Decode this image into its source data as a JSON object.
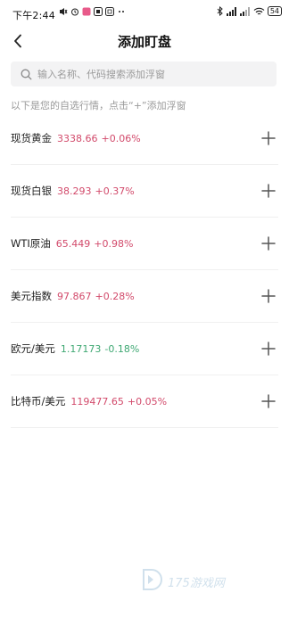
{
  "status_bar": {
    "time": "下午2:44",
    "battery": "54"
  },
  "header": {
    "title": "添加盯盘"
  },
  "search": {
    "placeholder": "输入名称、代码搜索添加浮窗"
  },
  "hint": "以下是您的自选行情，点击“+”添加浮窗",
  "items": [
    {
      "name": "现货黄金",
      "price": "3338.66",
      "change": "+0.06%",
      "trend": "up"
    },
    {
      "name": "现货白银",
      "price": "38.293",
      "change": "+0.37%",
      "trend": "up"
    },
    {
      "name": "WTI原油",
      "price": "65.449",
      "change": "+0.98%",
      "trend": "up"
    },
    {
      "name": "美元指数",
      "price": "97.867",
      "change": "+0.28%",
      "trend": "up"
    },
    {
      "name": "欧元/美元",
      "price": "1.17173",
      "change": "-0.18%",
      "trend": "down"
    },
    {
      "name": "比特币/美元",
      "price": "119477.65",
      "change": "+0.05%",
      "trend": "up"
    }
  ],
  "colors": {
    "up": "#d24a6b",
    "down": "#3fa873"
  },
  "watermark": "175游戏网"
}
